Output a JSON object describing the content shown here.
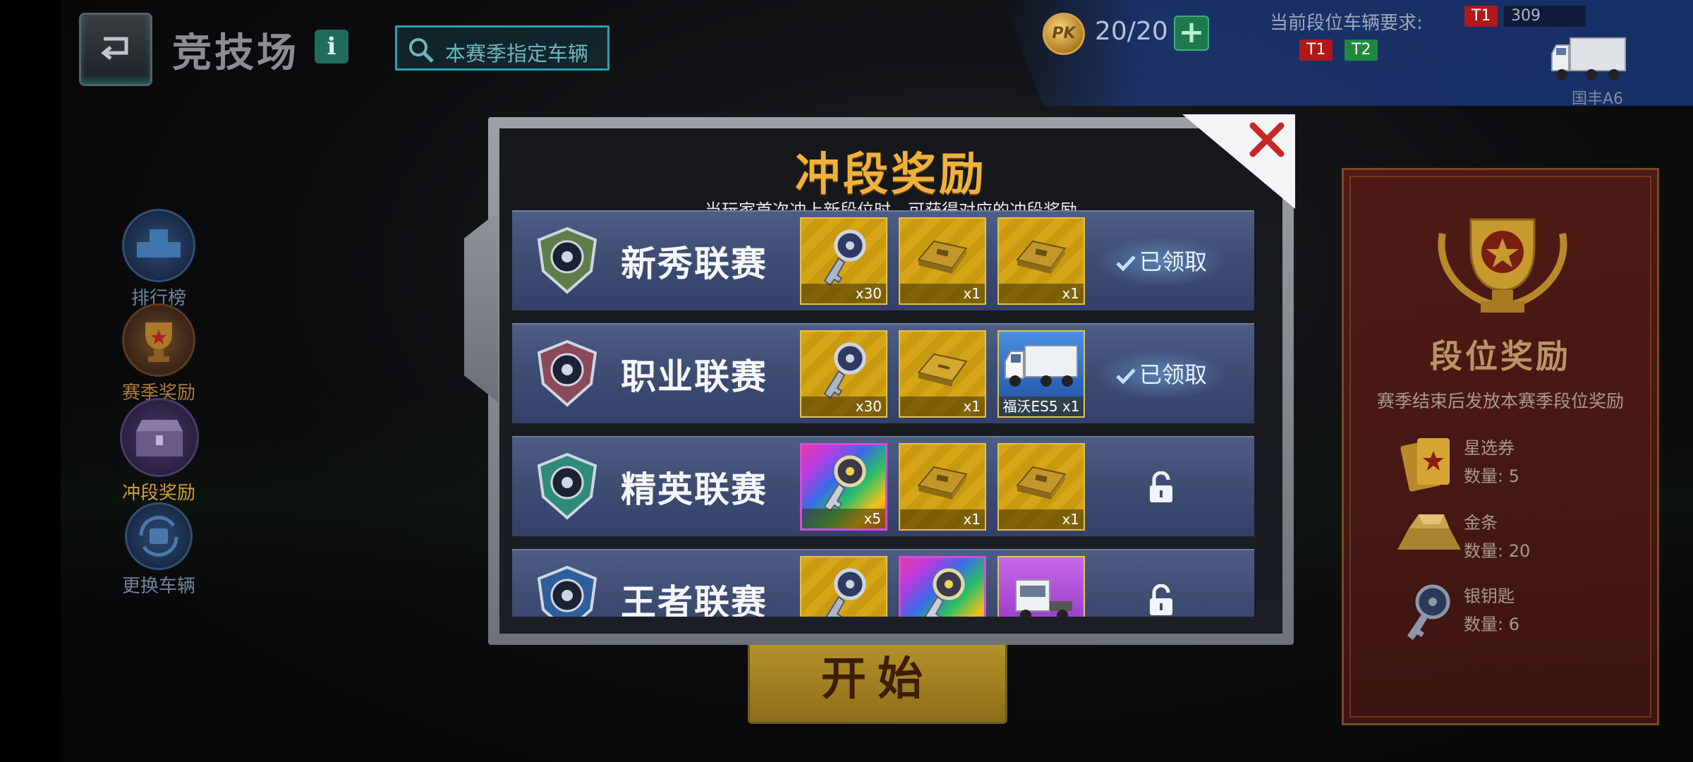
{
  "header": {
    "title": "竞技场",
    "info": "i",
    "search_label": "本赛季指定车辆",
    "coin_symbol": "PK",
    "coin_count": "20/20",
    "plus": "+",
    "requirement_label": "当前段位车辆要求:",
    "tag_t1_top": "T1",
    "tag_value": "309",
    "tag_t1": "T1",
    "tag_t2": "T2",
    "truck_name": "国丰A6"
  },
  "sidebar": {
    "items": [
      {
        "label": "排行榜"
      },
      {
        "label": "赛季奖励"
      },
      {
        "label": "冲段奖励"
      },
      {
        "label": "更换车辆"
      }
    ]
  },
  "rank_panel": {
    "title": "段位奖励",
    "subtitle": "赛季结束后发放本赛季段位奖励",
    "rewards": [
      {
        "name": "星选券",
        "qty": "数量: 5",
        "icon": "ticket-icon"
      },
      {
        "name": "金条",
        "qty": "数量: 20",
        "icon": "gold-bar-icon"
      },
      {
        "name": "银钥匙",
        "qty": "数量: 6",
        "icon": "silver-key-icon"
      }
    ]
  },
  "start_button": "开始",
  "modal": {
    "title": "冲段奖励",
    "subtitle": "当玩家首次冲上新段位时，可获得对应的冲段奖励",
    "claimed_label": "已领取",
    "tiers": [
      {
        "name": "新秀联赛",
        "status": "claimed",
        "rewards": [
          {
            "type": "silver-key",
            "label": "x30"
          },
          {
            "type": "gold-bar",
            "label": "x1"
          },
          {
            "type": "gold-bar",
            "label": "x1"
          }
        ]
      },
      {
        "name": "职业联赛",
        "status": "claimed",
        "rewards": [
          {
            "type": "silver-key",
            "label": "x30"
          },
          {
            "type": "ticket",
            "label": "x1"
          },
          {
            "type": "truck",
            "label": "福沃ES5 x1"
          }
        ]
      },
      {
        "name": "精英联赛",
        "status": "locked",
        "rewards": [
          {
            "type": "rainbow-key",
            "label": "x5"
          },
          {
            "type": "gold-bar",
            "label": "x1"
          },
          {
            "type": "gold-bar",
            "label": "x1"
          }
        ]
      },
      {
        "name": "王者联赛",
        "status": "locked",
        "rewards": [
          {
            "type": "silver-key",
            "label": ""
          },
          {
            "type": "rainbow-key",
            "label": ""
          },
          {
            "type": "truck-purple",
            "label": ""
          }
        ]
      }
    ]
  },
  "colors": {
    "accent_gold": "#f0b13c",
    "row_blue": "#3e4c72",
    "close_red": "#c62828"
  }
}
